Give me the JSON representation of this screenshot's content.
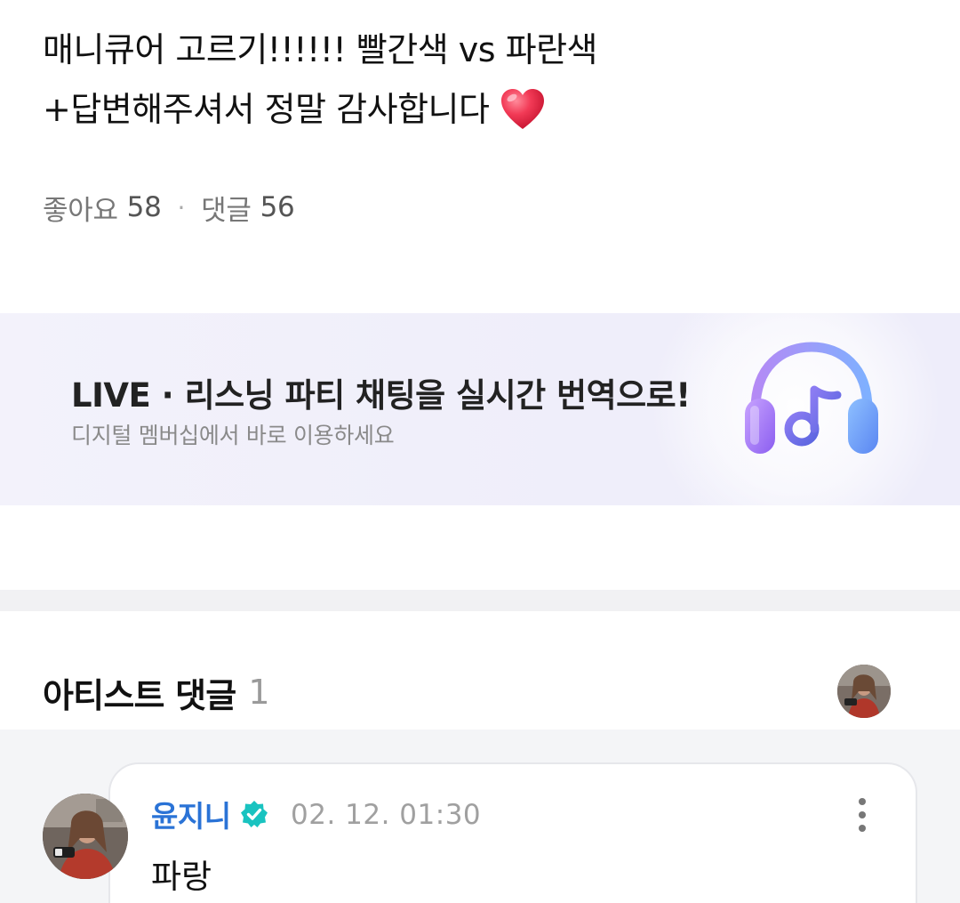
{
  "post": {
    "title_line1": "매니큐어 고르기!!!!!! 빨간색 vs 파란색",
    "title_line2": "+답변해주셔서 정말 감사합니다",
    "title_emoji": "red-heart",
    "likes_label": "좋아요",
    "likes_count": "58",
    "separator": "·",
    "comments_label": "댓글",
    "comments_count": "56"
  },
  "banner": {
    "title": "LIVE · 리스닝 파티 채팅을 실시간 번역으로!",
    "subtitle": "디지털 멤버십에서 바로 이용하세요",
    "icon": "headphones-music-icon",
    "icon_colors": [
      "#7aa5ff",
      "#a47bf0",
      "#5f67e0"
    ]
  },
  "artist_comments": {
    "header_label": "아티스트 댓글",
    "count": "1",
    "items": [
      {
        "author": "윤지니",
        "verified": true,
        "date": "02. 12. 01:30",
        "text": "파랑"
      }
    ]
  },
  "colors": {
    "author_blue": "#2a73d6",
    "verified_teal": "#19c3c0",
    "muted_gray": "#a0a0a0"
  }
}
